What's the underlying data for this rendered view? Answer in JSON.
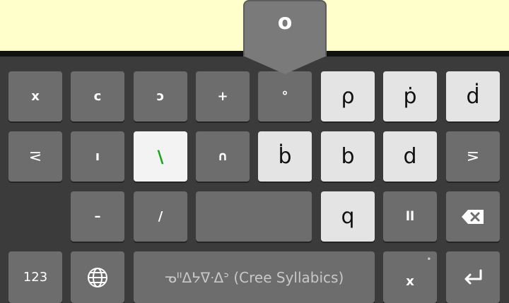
{
  "popup": {
    "label": "o"
  },
  "rows": [
    [
      "x",
      "c",
      "ɔ",
      "+",
      "°",
      "ρ",
      "ṗ",
      "ḋ"
    ],
    [
      "⋜",
      "ı",
      "\\",
      "∩",
      "ḃ",
      "b",
      "d",
      "⋝"
    ],
    [
      "–",
      "/",
      "",
      "q",
      "ll"
    ]
  ],
  "bottom": {
    "numbers_label": "123",
    "space_label": "ᓀᐦᐃᔭᐁᐧᐃᐣ (Cree Syllabics)",
    "period_key": "x",
    "period_hint": "•"
  },
  "icons": [
    "globe-icon",
    "backspace-icon",
    "enter-icon"
  ],
  "colors": {
    "app_bg": "#ffffcc",
    "kbd_bg": "#3b3b3b",
    "key_dark": "#6d6d6d",
    "key_light": "#e4e4e4",
    "accent": "#1aa31a"
  }
}
